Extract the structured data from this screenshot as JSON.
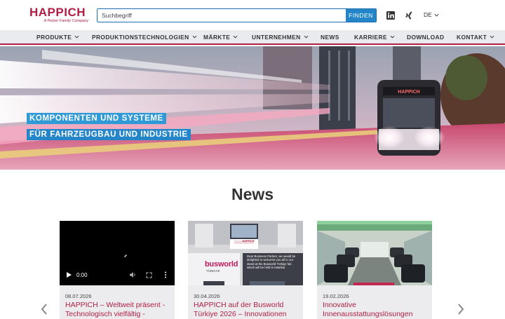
{
  "header": {
    "logo_text": "HAPPICH",
    "logo_tagline": "A Pelzer Family Company",
    "search_placeholder": "Suchbegriff",
    "search_button": "FINDEN",
    "language": "DE",
    "brand_color": "#b01e44",
    "accent_color": "#2486c9"
  },
  "nav": {
    "items": [
      {
        "label": "PRODUKTE"
      },
      {
        "label": "PRODUKTIONSTECHNOLOGIEN"
      },
      {
        "label": "MÄRKTE"
      },
      {
        "label": "UNTERNEHMEN"
      },
      {
        "label": "NEWS"
      },
      {
        "label": "KARRIERE"
      },
      {
        "label": "DOWNLOAD"
      },
      {
        "label": "KONTAKT"
      }
    ]
  },
  "hero": {
    "line1": "KOMPONENTEN UND SYSTEME",
    "line2": "FÜR FAHRZEUGBAU UND INDUSTRIE",
    "bus_sign": "HAPPICH"
  },
  "news": {
    "title": "News",
    "cards": [
      {
        "date": "08.07.2026",
        "title": "HAPPICH – Weltweit präsent - Technologisch vielfältig -",
        "video_time": "0:00"
      },
      {
        "date": "30.04.2026",
        "title": "HAPPICH auf der Busworld Türkiye 2026 – Innovationen",
        "thumb_brand": "busworld",
        "thumb_sub": "TÜRKIYE",
        "thumb_text": "Dear Business Partner, we would be delighted to welcome you all to our stand at the Busworld Türkiye fair, which will be held in Istanbul.",
        "thumb_logo": "HAPPICH"
      },
      {
        "date": "19.02.2026",
        "title": "Innovative Innenausstattungslösungen"
      }
    ]
  }
}
